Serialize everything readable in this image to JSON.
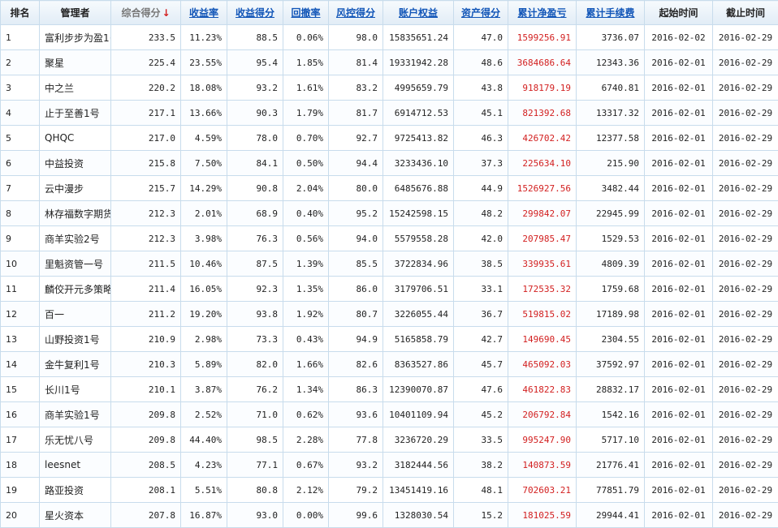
{
  "table": {
    "headers": [
      "排名",
      "管理者",
      "综合得分",
      "收益率",
      "收益得分",
      "回撤率",
      "风控得分",
      "账户权益",
      "资产得分",
      "累计净盈亏",
      "累计手续费",
      "起始时间",
      "截止时间"
    ],
    "sort_indicator": "↓",
    "rows": [
      [
        "1",
        "富利步步为盈1·",
        "233.5",
        "11.23%",
        "88.5",
        "0.06%",
        "98.0",
        "15835651.24",
        "47.0",
        "1599256.91",
        "3736.07",
        "2016-02-02",
        "2016-02-29"
      ],
      [
        "2",
        "聚星",
        "225.4",
        "23.55%",
        "95.4",
        "1.85%",
        "81.4",
        "19331942.28",
        "48.6",
        "3684686.64",
        "12343.36",
        "2016-02-01",
        "2016-02-29"
      ],
      [
        "3",
        "中之兰",
        "220.2",
        "18.08%",
        "93.2",
        "1.61%",
        "83.2",
        "4995659.79",
        "43.8",
        "918179.19",
        "6740.81",
        "2016-02-01",
        "2016-02-29"
      ],
      [
        "4",
        "止于至善1号",
        "217.1",
        "13.66%",
        "90.3",
        "1.79%",
        "81.7",
        "6914712.53",
        "45.1",
        "821392.68",
        "13317.32",
        "2016-02-01",
        "2016-02-29"
      ],
      [
        "5",
        "QHQC",
        "217.0",
        "4.59%",
        "78.0",
        "0.70%",
        "92.7",
        "9725413.82",
        "46.3",
        "426702.42",
        "12377.58",
        "2016-02-01",
        "2016-02-29"
      ],
      [
        "6",
        "中益投资",
        "215.8",
        "7.50%",
        "84.1",
        "0.50%",
        "94.4",
        "3233436.10",
        "37.3",
        "225634.10",
        "215.90",
        "2016-02-01",
        "2016-02-29"
      ],
      [
        "7",
        "云中漫步",
        "215.7",
        "14.29%",
        "90.8",
        "2.04%",
        "80.0",
        "6485676.88",
        "44.9",
        "1526927.56",
        "3482.44",
        "2016-02-01",
        "2016-02-29"
      ],
      [
        "8",
        "林存福数字期货",
        "212.3",
        "2.01%",
        "68.9",
        "0.40%",
        "95.2",
        "15242598.15",
        "48.2",
        "299842.07",
        "22945.99",
        "2016-02-01",
        "2016-02-29"
      ],
      [
        "9",
        "商羊实验2号",
        "212.3",
        "3.98%",
        "76.3",
        "0.56%",
        "94.0",
        "5579558.28",
        "42.0",
        "207985.47",
        "1529.53",
        "2016-02-01",
        "2016-02-29"
      ],
      [
        "10",
        "里魁资管一号",
        "211.5",
        "10.46%",
        "87.5",
        "1.39%",
        "85.5",
        "3722834.96",
        "38.5",
        "339935.61",
        "4809.39",
        "2016-02-01",
        "2016-02-29"
      ],
      [
        "11",
        "麟佼开元多策略",
        "211.4",
        "16.05%",
        "92.3",
        "1.35%",
        "86.0",
        "3179706.51",
        "33.1",
        "172535.32",
        "1759.68",
        "2016-02-01",
        "2016-02-29"
      ],
      [
        "12",
        "百一",
        "211.2",
        "19.20%",
        "93.8",
        "1.92%",
        "80.7",
        "3226055.44",
        "36.7",
        "519815.02",
        "17189.98",
        "2016-02-01",
        "2016-02-29"
      ],
      [
        "13",
        "山野投资1号",
        "210.9",
        "2.98%",
        "73.3",
        "0.43%",
        "94.9",
        "5165858.79",
        "42.7",
        "149690.45",
        "2304.55",
        "2016-02-01",
        "2016-02-29"
      ],
      [
        "14",
        "金牛复利1号",
        "210.3",
        "5.89%",
        "82.0",
        "1.66%",
        "82.6",
        "8363527.86",
        "45.7",
        "465092.03",
        "37592.97",
        "2016-02-01",
        "2016-02-29"
      ],
      [
        "15",
        "长川1号",
        "210.1",
        "3.87%",
        "76.2",
        "1.34%",
        "86.3",
        "12390070.87",
        "47.6",
        "461822.83",
        "28832.17",
        "2016-02-01",
        "2016-02-29"
      ],
      [
        "16",
        "商羊实验1号",
        "209.8",
        "2.52%",
        "71.0",
        "0.62%",
        "93.6",
        "10401109.94",
        "45.2",
        "206792.84",
        "1542.16",
        "2016-02-01",
        "2016-02-29"
      ],
      [
        "17",
        "乐无忧八号",
        "209.8",
        "44.40%",
        "98.5",
        "2.28%",
        "77.8",
        "3236720.29",
        "33.5",
        "995247.90",
        "5717.10",
        "2016-02-01",
        "2016-02-29"
      ],
      [
        "18",
        "leesnet",
        "208.5",
        "4.23%",
        "77.1",
        "0.67%",
        "93.2",
        "3182444.56",
        "38.2",
        "140873.59",
        "21776.41",
        "2016-02-01",
        "2016-02-29"
      ],
      [
        "19",
        "路亚投资",
        "208.1",
        "5.51%",
        "80.8",
        "2.12%",
        "79.2",
        "13451419.16",
        "48.1",
        "702603.21",
        "77851.79",
        "2016-02-01",
        "2016-02-29"
      ],
      [
        "20",
        "星火资本",
        "207.8",
        "16.87%",
        "93.0",
        "0.00%",
        "99.6",
        "1328030.54",
        "15.2",
        "181025.59",
        "29944.41",
        "2016-02-01",
        "2016-02-29"
      ]
    ]
  }
}
